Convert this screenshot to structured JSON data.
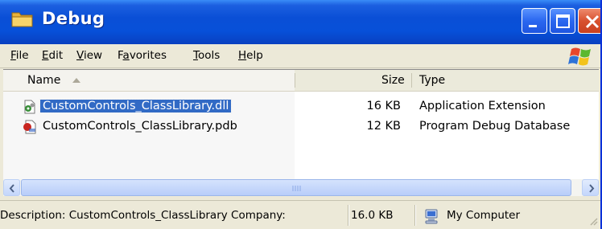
{
  "window": {
    "title": "Debug",
    "controls": [
      "minimize-icon",
      "maximize-icon",
      "close-icon"
    ],
    "title_color": "#0a4fd6"
  },
  "menu": {
    "items": [
      {
        "label": "File",
        "mnemonic": "F"
      },
      {
        "label": "Edit",
        "mnemonic": "E"
      },
      {
        "label": "View",
        "mnemonic": "V"
      },
      {
        "label": "Favorites",
        "mnemonic": "a"
      },
      {
        "label": "Tools",
        "mnemonic": "T"
      },
      {
        "label": "Help",
        "mnemonic": "H"
      }
    ]
  },
  "list": {
    "columns": [
      "Name",
      "Size",
      "Type"
    ],
    "sorted_by": "Name",
    "rows": [
      {
        "name": "CustomControls_ClassLibrary.dll",
        "size": "16 KB",
        "type": "Application Extension",
        "icon": "dll-file-icon",
        "selected": true
      },
      {
        "name": "CustomControls_ClassLibrary.pdb",
        "size": "12 KB",
        "type": "Program Debug Database",
        "icon": "pdb-file-icon",
        "selected": false
      }
    ],
    "selection_color": "#316ac5"
  },
  "status": {
    "description": "Description: CustomControls_ClassLibrary Company: ",
    "size": "16.0 KB",
    "location": "My Computer"
  }
}
